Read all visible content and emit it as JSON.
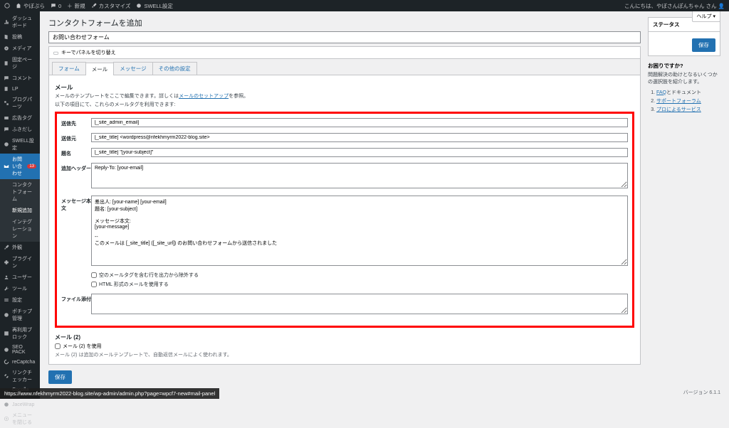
{
  "adminbar": {
    "site": "やぼぷら",
    "new": "新規",
    "customize": "カスタマイズ",
    "swell": "SWELL設定",
    "howdy": "こんにちは、やぼさんぽんちゃん さん",
    "comment_badge": "0"
  },
  "help_tab": "ヘルプ ▾",
  "sidebar": {
    "items": [
      "ダッシュボード",
      "投稿",
      "メディア",
      "固定ページ",
      "コメント",
      "LP",
      "ブログパーツ",
      "広告タグ",
      "ふきだし",
      "SWELL設定",
      "お問い合わせ"
    ],
    "subs": [
      "コンタクトフォーム",
      "新規追加",
      "インテグレーション"
    ],
    "items2": [
      "外観",
      "プラグイン",
      "ユーザー",
      "ツール",
      "設定",
      "ポチップ管理",
      "再利用ブロック",
      "SEO PACK",
      "reCaptcha",
      "リンクチェッカー",
      "Cocolla WING",
      "JaceWrap",
      "メニューを閉じる"
    ],
    "notice_count": "13"
  },
  "page": {
    "h1": "コンタクトフォームを追加",
    "title_value": "お問い合わせフォーム",
    "keyboard_bar": "キーでパネルを切り替え",
    "tabs": [
      "フォーム",
      "メール",
      "メッセージ",
      "その他の設定"
    ],
    "section_title": "メール",
    "desc1": "メールのテンプレートをここで編集できます。詳しくは",
    "desc1_link": "メールのセットアップ",
    "desc1_after": "を参照。",
    "desc2": "以下の項目にて、これらのメールタグを利用できます:"
  },
  "fields": {
    "to": {
      "label": "送信先",
      "value": "[_site_admin_email]"
    },
    "from": {
      "label": "送信元",
      "value": "[_site_title] <wordpress@nfekhmyrm2022-blog.site>"
    },
    "subject": {
      "label": "題名",
      "value": "[_site_title] \"[your-subject]\""
    },
    "headers": {
      "label": "追加ヘッダー",
      "value": "Reply-To: [your-email]"
    },
    "body": {
      "label": "メッセージ本文",
      "value": "差出人: [your-name] [your-email]\n題名: [your-subject]\n\nメッセージ本文:\n[your-message]\n\n-- \nこのメールは [_site_title] ([_site_url]) のお問い合わせフォームから送信されました"
    },
    "exclude_blank": "空のメールタグを含む行を出力から除外する",
    "use_html": "HTML 形式のメールを使用する",
    "attach": {
      "label": "ファイル添付",
      "value": ""
    }
  },
  "mail2": {
    "title": "メール (2)",
    "checkbox": "メール (2) を使用",
    "note": "メール (2) は追加のメールテンプレートで、自動返信メールによく使われます。"
  },
  "save_btn": "保存",
  "status_box": {
    "title": "ステータス",
    "save": "保存"
  },
  "help_box": {
    "title": "お困りですか?",
    "text": "問題解決の助けとなるいくつかの選択肢を紹介します。",
    "items": [
      {
        "prefix": "FAQ",
        "rest": "とドキュメント"
      },
      {
        "prefix": "",
        "rest": "サポートフォーラム"
      },
      {
        "prefix": "",
        "rest": "プロによるサービス"
      }
    ]
  },
  "status_url": "https://www.nfekhmyrm2022-blog.site/wp-admin/admin.php?page=wpcf7-new#mail-panel",
  "version": "バージョン 6.1.1"
}
